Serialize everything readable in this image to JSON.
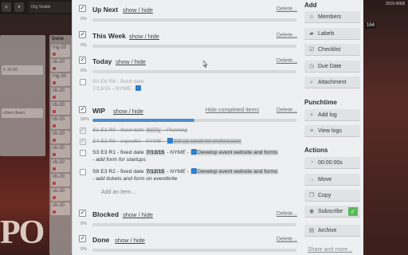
{
  "board": {
    "org_label": "Org Visible",
    "bar_icons": [
      "⌕",
      "•"
    ],
    "left_cards": [
      "5 16:50",
      "cities down"
    ],
    "list2_title": "Done",
    "list2_cards": [
      "mg-20",
      "cb-20",
      "mg-20",
      "cb-20",
      "cb-20",
      "cb-20",
      "cb-20",
      "cb-20",
      "cb-20",
      "cb-20",
      "cb-20",
      "cb-20"
    ],
    "right_text": "2015-WEB",
    "right_num": "164",
    "bg_word": "PO"
  },
  "checklists": [
    {
      "id": "up-next",
      "title": "Up Next",
      "toggle": "show / hide",
      "delete": "Delete...",
      "percent": "0%",
      "progress": 0
    },
    {
      "id": "this-week",
      "title": "This Week",
      "toggle": "show / hide",
      "delete": "Delete...",
      "percent": "0%",
      "progress": 0
    },
    {
      "id": "today",
      "title": "Today",
      "toggle": "show / hide",
      "delete": "Delete...",
      "percent": "0%",
      "progress": 0
    }
  ],
  "today_item": {
    "line1": "S0 E6 R6 - fixed date",
    "line2": "7/13/15 - NYME - "
  },
  "wip": {
    "title": "WIP",
    "toggle": "show / hide",
    "hide_completed": "Hide completed items",
    "delete": "Delete...",
    "percent": "50%",
    "progress": 50,
    "items": [
      {
        "pre": "S1 E1 R0 - fixed date ",
        "code": "daily",
        "post": " - Planning"
      },
      {
        "pre": "S4 E3 R0 - expedite - NYME - ",
        "link": "Set up email for mefest.com"
      },
      {
        "pre": "S3 E3 R1 - fixed date ",
        "date": "7/13/15",
        "mid": " - NYME - ",
        "link": "Develop event website and forms",
        "post": "- add form for startups"
      },
      {
        "pre": "S8 E3 R2 - fixed date ",
        "date": "7/12/15",
        "mid": " - NYME - ",
        "link": "Develop event website and forms",
        "post": "- add tickets and form on eventbrite"
      }
    ],
    "add_item": "Add an item..."
  },
  "blocked": {
    "title": "Blocked",
    "toggle": "show / hide",
    "delete": "Delete...",
    "percent": "0%",
    "progress": 0
  },
  "done": {
    "title": "Done",
    "toggle": "show / hide",
    "delete": "Delete...",
    "percent": "0%",
    "progress": 0
  },
  "sidebar": {
    "add_heading": "Add",
    "add_buttons": [
      {
        "icon": "member-icon",
        "glyph": "☺",
        "label": "Members"
      },
      {
        "icon": "label-icon",
        "glyph": "▰",
        "label": "Labels"
      },
      {
        "icon": "checklist-icon",
        "glyph": "☑",
        "label": "Checklist"
      },
      {
        "icon": "clock-icon",
        "glyph": "◷",
        "label": "Due Date"
      },
      {
        "icon": "attachment-icon",
        "glyph": "⌕",
        "label": "Attachment"
      }
    ],
    "punchtime_heading": "Punchtime",
    "punch_buttons": [
      {
        "icon": "plus-icon",
        "glyph": "+",
        "label": "Add log"
      },
      {
        "icon": "list-icon",
        "glyph": "≡",
        "label": "View logs"
      }
    ],
    "actions_heading": "Actions",
    "action_buttons": [
      {
        "icon": "timer-icon",
        "glyph": "◔",
        "label": "00:00:00s"
      },
      {
        "icon": "move-icon",
        "glyph": "→",
        "label": "Move"
      },
      {
        "icon": "copy-icon",
        "glyph": "❐",
        "label": "Copy"
      },
      {
        "icon": "subscribe-icon",
        "glyph": "◉",
        "label": "Subscribe"
      },
      {
        "icon": "archive-icon",
        "glyph": "▤",
        "label": "Archive"
      }
    ],
    "subscribe_check": "✓",
    "more_link": "Share and more..."
  },
  "colors": {
    "accent": "#4a8fd0",
    "subscribe_green": "#5bb85d",
    "panel": "#edeff0"
  }
}
